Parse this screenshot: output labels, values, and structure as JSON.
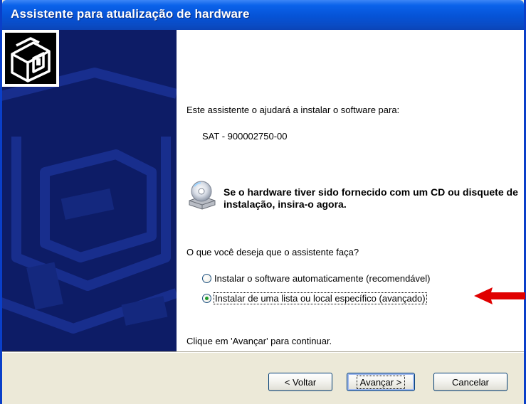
{
  "window": {
    "title": "Assistente para atualização de hardware"
  },
  "main": {
    "intro": "Este assistente o ajudará a instalar o software para:",
    "device_name": "SAT - 900002750-00",
    "cd_notice": "Se o hardware tiver sido fornecido com um CD ou disquete de instalação, insira-o agora.",
    "question": "O que você deseja que o assistente faça?",
    "options": [
      {
        "label": "Instalar o software automaticamente (recomendável)",
        "selected": false
      },
      {
        "label": "Instalar de uma lista ou local específico (avançado)",
        "selected": true
      }
    ],
    "continue_hint": "Clique em 'Avançar' para continuar."
  },
  "buttons": {
    "back": "< Voltar",
    "next": "Avançar >",
    "cancel": "Cancelar"
  },
  "icons": {
    "hardware": "hardware-wizard-icon",
    "cd": "cd-drive-icon",
    "arrow": "red-arrow-icon"
  },
  "colors": {
    "title_bar": "#0a5ee3",
    "sidebar": "#0d1c66",
    "arrow": "#e00000",
    "selected_radio": "#1f9b2c"
  }
}
